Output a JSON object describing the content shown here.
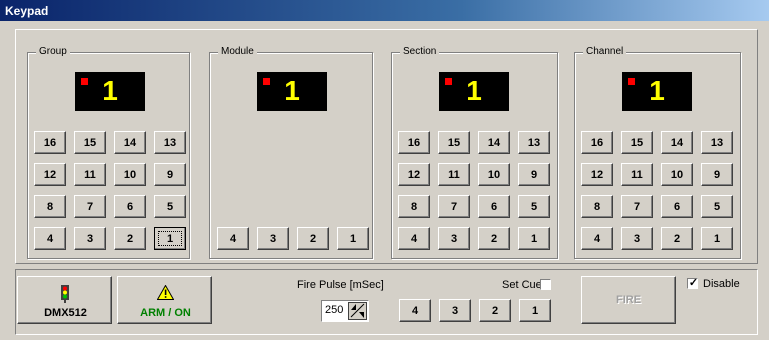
{
  "window": {
    "title": "Keypad"
  },
  "groups": [
    {
      "label": "Group",
      "display": "1"
    },
    {
      "label": "Module",
      "display": "1"
    },
    {
      "label": "Section",
      "display": "1"
    },
    {
      "label": "Channel",
      "display": "1"
    }
  ],
  "keypad_rows": [
    [
      "16",
      "15",
      "14",
      "13"
    ],
    [
      "12",
      "11",
      "10",
      "9"
    ],
    [
      "8",
      "7",
      "6",
      "5"
    ],
    [
      "4",
      "3",
      "2",
      "1"
    ]
  ],
  "bottom": {
    "dmx_label": "DMX512",
    "arm_label": "ARM / ON",
    "fire_pulse_label": "Fire Pulse [mSec]",
    "fire_pulse_value": "250",
    "set_cue_label": "Set Cue",
    "cue_buttons": [
      "4",
      "3",
      "2",
      "1"
    ],
    "fire_label": "FIRE",
    "disable_label": "Disable",
    "disable_checked": true,
    "set_cue_checked": false
  },
  "colors": {
    "led": "#ff0000",
    "digit": "#ffff00",
    "arm_text": "#008000",
    "disabled_text": "#a0a0a0"
  }
}
